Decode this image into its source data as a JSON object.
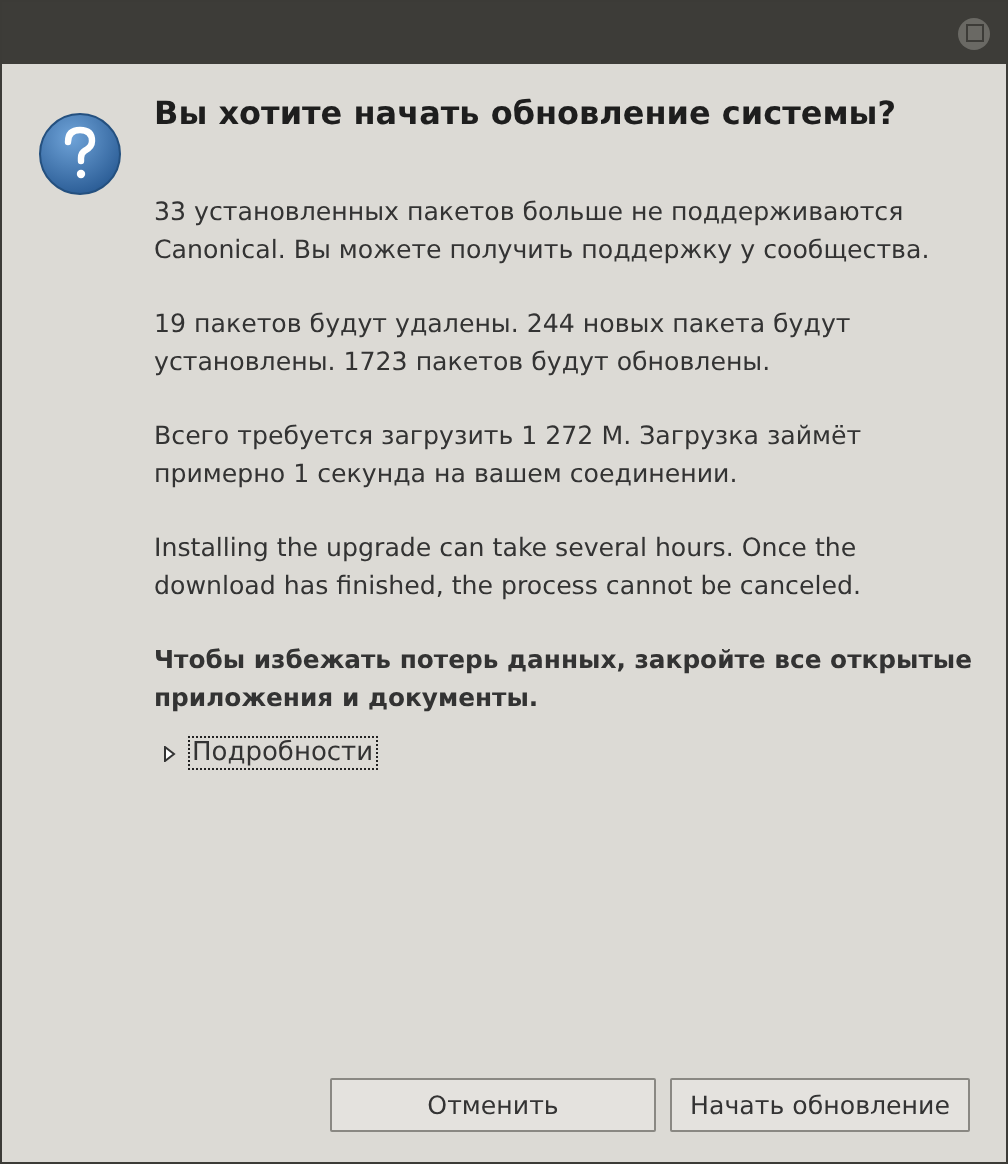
{
  "window": {
    "maximize_button": true
  },
  "dialog": {
    "heading": "Вы хотите начать обновление системы?",
    "paragraphs": [
      {
        "text": "33 установленных пакетов больше не поддерживаются Canonical. Вы можете получить поддержку у сообщества.",
        "bold": false
      },
      {
        "text": "19 пакетов будут удалены. 244 новых пакета будут установлены. 1723 пакетов будут обновлены.",
        "bold": false
      },
      {
        "text": "Всего требуется загрузить 1 272 M. Загрузка займёт примерно 1 секунда на вашем соединении.",
        "bold": false
      },
      {
        "text": "Installing the upgrade can take several hours. Once the download has finished, the process cannot be canceled.",
        "bold": false
      },
      {
        "text": "Чтобы избежать потерь данных, закройте все открытые приложения и документы.",
        "bold": true
      }
    ],
    "details": {
      "label": "Подробности",
      "expanded": false
    }
  },
  "buttons": [
    {
      "label": "Отменить"
    },
    {
      "label": "Начать обновление"
    }
  ]
}
